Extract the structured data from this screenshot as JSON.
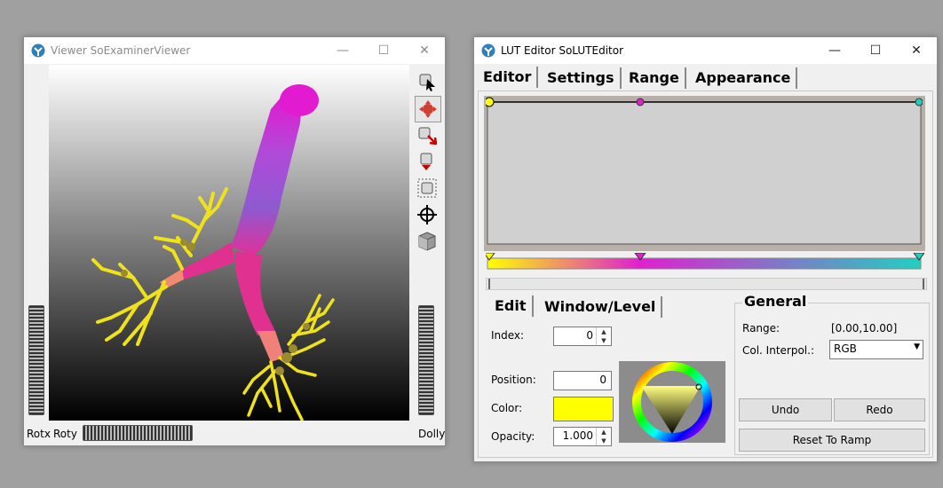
{
  "viewer": {
    "title": "Viewer SoExaminerViewer",
    "tools": [
      "pick-arrow-icon",
      "rotate-hand-icon",
      "seek-icon",
      "home-icon",
      "view-all-icon",
      "set-home-icon",
      "projection-cube-icon"
    ],
    "labels": {
      "rotx": "Rotx",
      "roty": "Roty",
      "dolly": "Dolly"
    }
  },
  "lut": {
    "title": "LUT Editor SoLUTEditor",
    "tabs": [
      "Editor",
      "Settings",
      "Range",
      "Appearance"
    ],
    "subtabs": [
      "Edit",
      "Window/Level"
    ],
    "index_label": "Index:",
    "index_value": "0",
    "position_label": "Position:",
    "position_value": "0",
    "color_label": "Color:",
    "color_value": "#ffff00",
    "opacity_label": "Opacity:",
    "opacity_value": "1.000",
    "general": {
      "title": "General",
      "range_label": "Range:",
      "range_value": "[0.00,10.00]",
      "interp_label": "Col. Interpol.:",
      "interp_value": "RGB"
    },
    "buttons": {
      "undo": "Undo",
      "redo": "Redo",
      "reset": "Reset To Ramp"
    },
    "colors": {
      "start": "#ffff00",
      "mid": "#e020d0",
      "end": "#20d0c0"
    }
  },
  "window_controls": {
    "minimize": "—",
    "maximize": "☐",
    "close": "✕"
  }
}
